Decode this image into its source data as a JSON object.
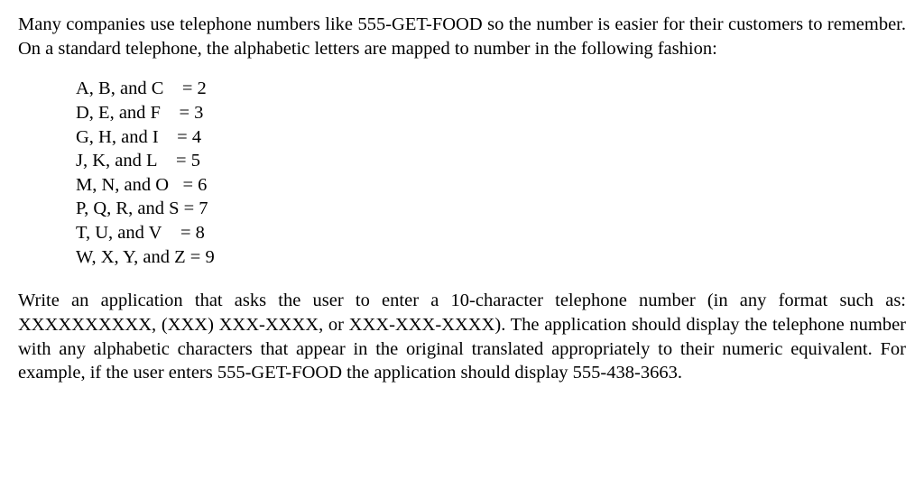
{
  "intro": "Many companies use telephone numbers like 555-GET-FOOD so the number is easier for their customers to remember.  On a standard telephone, the alphabetic letters are mapped to number in the following fashion:",
  "mappings": [
    {
      "left": "A, B, and C",
      "right": "= 2"
    },
    {
      "left": "D, E, and F",
      "right": "= 3"
    },
    {
      "left": "G, H, and I",
      "right": "= 4"
    },
    {
      "left": "J, K, and L",
      "right": "= 5"
    },
    {
      "left": "M, N, and O",
      "right": "= 6"
    },
    {
      "left": "P, Q, R, and S",
      "right": "= 7"
    },
    {
      "left": "T, U, and V",
      "right": "= 8"
    },
    {
      "left": "W, X, Y, and Z",
      "right": "= 9"
    }
  ],
  "instructions": "Write an application that asks the user to enter a 10-character telephone number (in any format such as: XXXXXXXXXX, (XXX) XXX-XXXX, or XXX-XXX-XXXX).  The application should display the telephone number with any alphabetic characters that appear in the original translated appropriately to their numeric equivalent.  For example, if the user enters 555-GET-FOOD the application should display 555-438-3663."
}
